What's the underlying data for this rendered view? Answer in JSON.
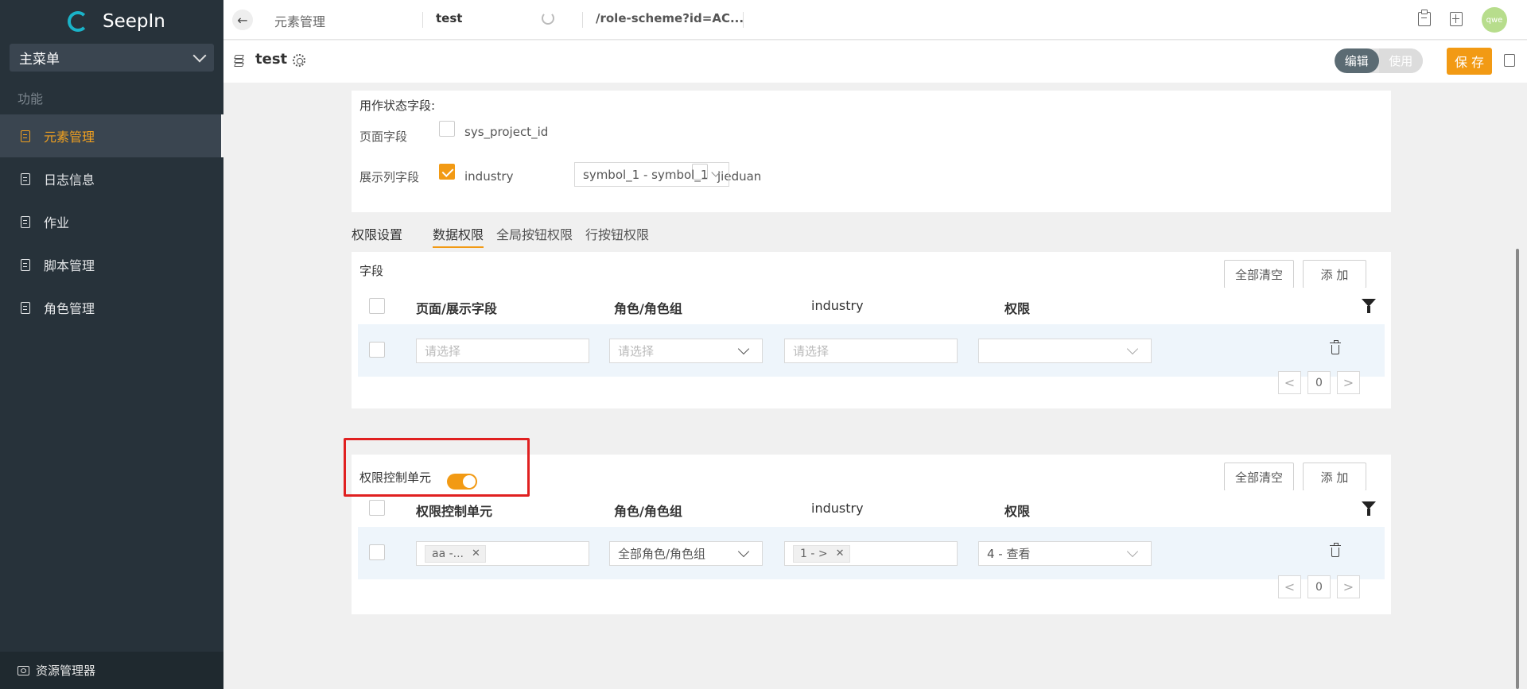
{
  "app": {
    "name": "SeepIn"
  },
  "sidebar": {
    "menu_select": "主菜单",
    "section": "功能",
    "items": [
      {
        "label": "元素管理",
        "active": true
      },
      {
        "label": "日志信息",
        "active": false
      },
      {
        "label": "作业",
        "active": false
      },
      {
        "label": "脚本管理",
        "active": false
      },
      {
        "label": "角色管理",
        "active": false
      }
    ],
    "footer": "资源管理器"
  },
  "topbar": {
    "breadcrumb": "元素管理",
    "tab_name": "test",
    "url": "/role-scheme?id=AC...",
    "avatar": "qwe"
  },
  "titlebar": {
    "title": "test",
    "mode_edit": "编辑",
    "mode_use": "使用",
    "save": "保 存"
  },
  "status_fields": {
    "heading": "用作状态字段:",
    "page_field_label": "页面字段",
    "page_field_value": "sys_project_id",
    "display_field_label": "展示列字段",
    "display_field_value": "industry",
    "display_field_checked": true,
    "symbol_select": "symbol_1 - symbol_1",
    "jieduan": "jieduan"
  },
  "tabs": [
    "权限设置",
    "数据权限",
    "全局按钮权限",
    "行按钮权限"
  ],
  "active_tab": "数据权限",
  "field_section": {
    "title": "字段",
    "clear_all": "全部清空",
    "add": "添 加",
    "columns": [
      "页面/展示字段",
      "角色/角色组",
      "industry",
      "权限"
    ],
    "row": {
      "field_placeholder": "请选择",
      "role_placeholder": "请选择",
      "industry_placeholder": "请选择",
      "permission": ""
    },
    "page": "0"
  },
  "unit_section": {
    "title": "权限控制单元",
    "toggle_on": true,
    "clear_all": "全部清空",
    "add": "添 加",
    "columns": [
      "权限控制单元",
      "角色/角色组",
      "industry",
      "权限"
    ],
    "row": {
      "unit_tag": "aa -...",
      "role": "全部角色/角色组",
      "industry_tag": "1 - >",
      "permission": "4 - 查看"
    },
    "page": "0"
  },
  "colors": {
    "accent": "#f29a14",
    "sidebar_bg": "#27323a",
    "highlight": "#e02020",
    "logo": "#1ab3c8"
  }
}
